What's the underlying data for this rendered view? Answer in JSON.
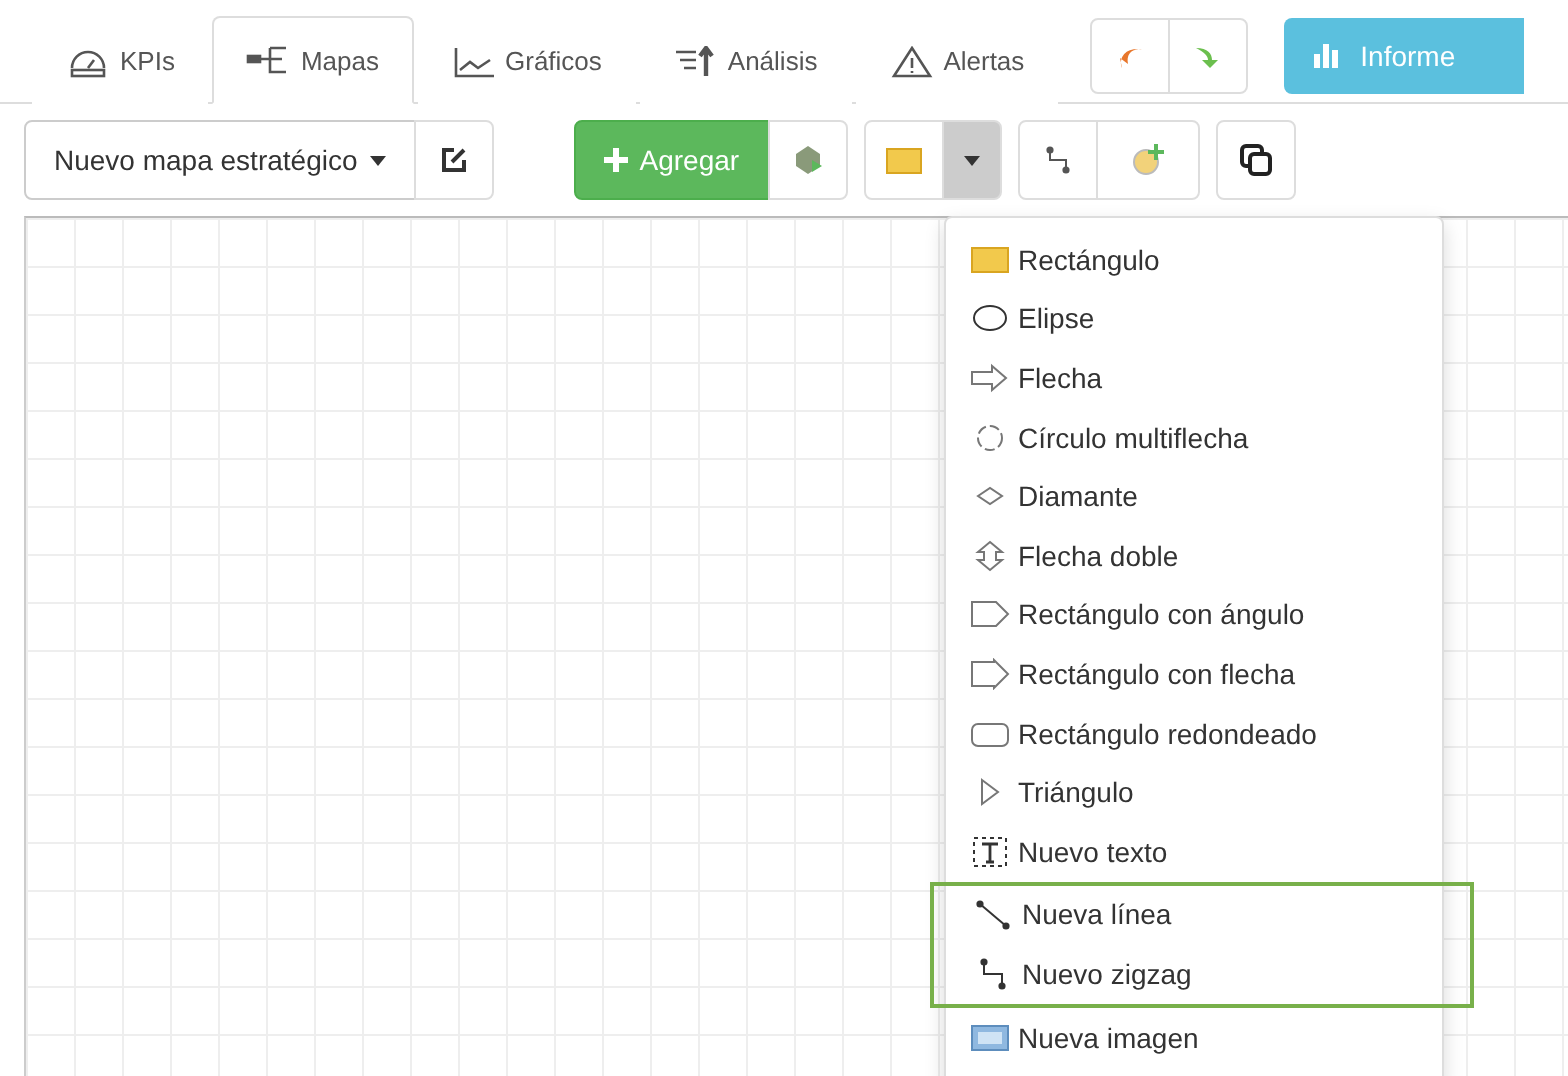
{
  "tabs": [
    {
      "label": "KPIs",
      "kind": "gauge",
      "selected": false
    },
    {
      "label": "Mapas",
      "kind": "map",
      "selected": true
    },
    {
      "label": "Gráficos",
      "kind": "chart",
      "selected": false
    },
    {
      "label": "Análisis",
      "kind": "sort",
      "selected": false
    },
    {
      "label": "Alertas",
      "kind": "warning",
      "selected": false
    }
  ],
  "report_button": "Informe",
  "toolbar": {
    "map_select": "Nuevo mapa estratégico",
    "add_button": "Agregar",
    "shape_menu_expanded": true
  },
  "shape_menu": [
    {
      "label": "Rectángulo",
      "kind": "rect",
      "highlighted": false
    },
    {
      "label": "Elipse",
      "kind": "ellipse",
      "highlighted": false
    },
    {
      "label": "Flecha",
      "kind": "arrow",
      "highlighted": false
    },
    {
      "label": "Círculo multiflecha",
      "kind": "circle",
      "highlighted": false
    },
    {
      "label": "Diamante",
      "kind": "diamond",
      "highlighted": false
    },
    {
      "label": "Flecha doble",
      "kind": "double",
      "highlighted": false
    },
    {
      "label": "Rectángulo con ángulo",
      "kind": "pentagon",
      "highlighted": false
    },
    {
      "label": "Rectángulo con flecha",
      "kind": "rectarrow",
      "highlighted": false
    },
    {
      "label": "Rectángulo redondeado",
      "kind": "rounded",
      "highlighted": false
    },
    {
      "label": "Triángulo",
      "kind": "triangle",
      "highlighted": false
    },
    {
      "label": "Nuevo texto",
      "kind": "text",
      "highlighted": false
    },
    {
      "label": "Nueva línea",
      "kind": "line",
      "highlighted": true
    },
    {
      "label": "Nuevo zigzag",
      "kind": "zigzag",
      "highlighted": true
    },
    {
      "label": "Nueva imagen",
      "kind": "image",
      "highlighted": false
    }
  ]
}
